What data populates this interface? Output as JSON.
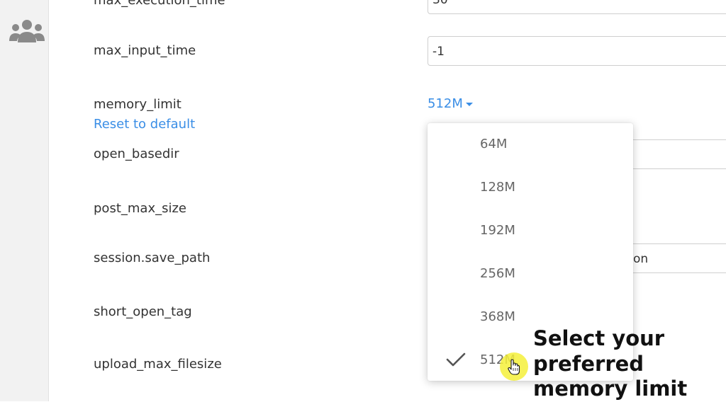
{
  "sidebar": {
    "icon": "users-icon"
  },
  "settings": {
    "max_execution_time": {
      "label": "max_execution_time",
      "value": "30"
    },
    "max_input_time": {
      "label": "max_input_time",
      "value": "-1"
    },
    "memory_limit": {
      "label": "memory_limit",
      "value": "512M",
      "reset_label": "Reset to default"
    },
    "open_basedir": {
      "label": "open_basedir",
      "value": ""
    },
    "post_max_size": {
      "label": "post_max_size"
    },
    "session_save_path": {
      "label": "session.save_path",
      "value_visible_fragment": "on"
    },
    "short_open_tag": {
      "label": "short_open_tag"
    },
    "upload_max_filesize": {
      "label": "upload_max_filesize"
    }
  },
  "memory_dropdown": {
    "options": [
      "64M",
      "128M",
      "192M",
      "256M",
      "368M",
      "512M"
    ],
    "selected": "512M",
    "check_icon": "check-icon"
  },
  "annotation": {
    "text": "Select your\npreferred\nmemory limit"
  },
  "colors": {
    "link": "#3a8ee6",
    "highlight": "#f4f03a",
    "sidebar": "#f2f2f2"
  }
}
